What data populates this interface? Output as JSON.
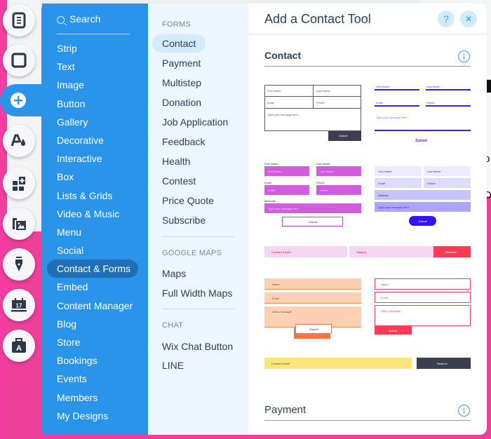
{
  "tool_rail": [
    {
      "name": "pages-icon"
    },
    {
      "name": "background-icon"
    },
    {
      "name": "add-icon",
      "active": true
    },
    {
      "name": "theme-icon"
    },
    {
      "name": "add-apps-icon"
    },
    {
      "name": "media-icon"
    },
    {
      "name": "blog-pen-icon"
    },
    {
      "name": "bookings-calendar-icon",
      "label": "17"
    },
    {
      "name": "business-icon",
      "label": "A"
    }
  ],
  "categories": {
    "search_placeholder": "Search",
    "items": [
      "Strip",
      "Text",
      "Image",
      "Button",
      "Gallery",
      "Decorative",
      "Interactive",
      "Box",
      "Lists & Grids",
      "Video & Music",
      "Menu",
      "Social",
      "Contact & Forms",
      "Embed",
      "Content Manager",
      "Blog",
      "Store",
      "Bookings",
      "Events",
      "Members",
      "My Designs"
    ],
    "selected": "Contact & Forms"
  },
  "subpanel": {
    "forms_heading": "FORMS",
    "forms": [
      "Contact",
      "Payment",
      "Multistep",
      "Donation",
      "Job Application",
      "Feedback",
      "Health",
      "Contest",
      "Price Quote",
      "Subscribe"
    ],
    "selected": "Contact",
    "maps_heading": "GOOGLE MAPS",
    "maps": [
      "Maps",
      "Full Width Maps"
    ],
    "chat_heading": "CHAT",
    "chat": [
      "Wix Chat Button",
      "LINE"
    ]
  },
  "content": {
    "title": "Add a Contact Tool",
    "help_label": "?",
    "close_label": "✕",
    "sections": [
      {
        "title": "Contact"
      },
      {
        "title": "Payment"
      }
    ],
    "info_label": "i",
    "presets": {
      "p1": {
        "first": "First Name",
        "last": "Last Name",
        "email": "Email",
        "phone": "Phone",
        "message": "Type your message here ...",
        "submit": "Submit"
      },
      "p2": {
        "first": "First Name",
        "last": "Last Name",
        "email": "Email",
        "phone": "Phone",
        "message": "Type your message here ...",
        "submit": "Submit"
      },
      "p3": {
        "first_label": "First Name",
        "last_label": "Last Name",
        "first": "First Name",
        "last": "Last Name",
        "email_label": "Email",
        "phone_label": "Phone",
        "email": "Email",
        "phone": "Phone",
        "message_label": "Message",
        "message": "Type your message here",
        "submit": "Submit"
      },
      "p4": {
        "first": "First Name",
        "last": "Last Name",
        "email": "Email",
        "phone": "Phone",
        "address": "Address",
        "message": "Type your message here ...",
        "submit": "Submit"
      },
      "p5": {
        "email": "Contact Email*",
        "subject": "Subject",
        "submit": "Reserve"
      },
      "p6": {
        "name": "Name",
        "email": "Email",
        "message": "Add a message",
        "submit": "Submit"
      },
      "p7": {
        "name": "Name",
        "email": "Email",
        "message": "Add a message",
        "submit": "Submit"
      },
      "p8": {
        "email": "Contact Email*",
        "submit": "Reserve"
      }
    }
  },
  "background": {
    "right_text": [
      "b",
      "De"
    ]
  },
  "colors": {
    "accent": "#2a94ea",
    "pink_bg": "#ee3f9b",
    "selected_category": "#1f6fb5",
    "sub_panel": "#edf6fe",
    "title": "#2b4156"
  }
}
